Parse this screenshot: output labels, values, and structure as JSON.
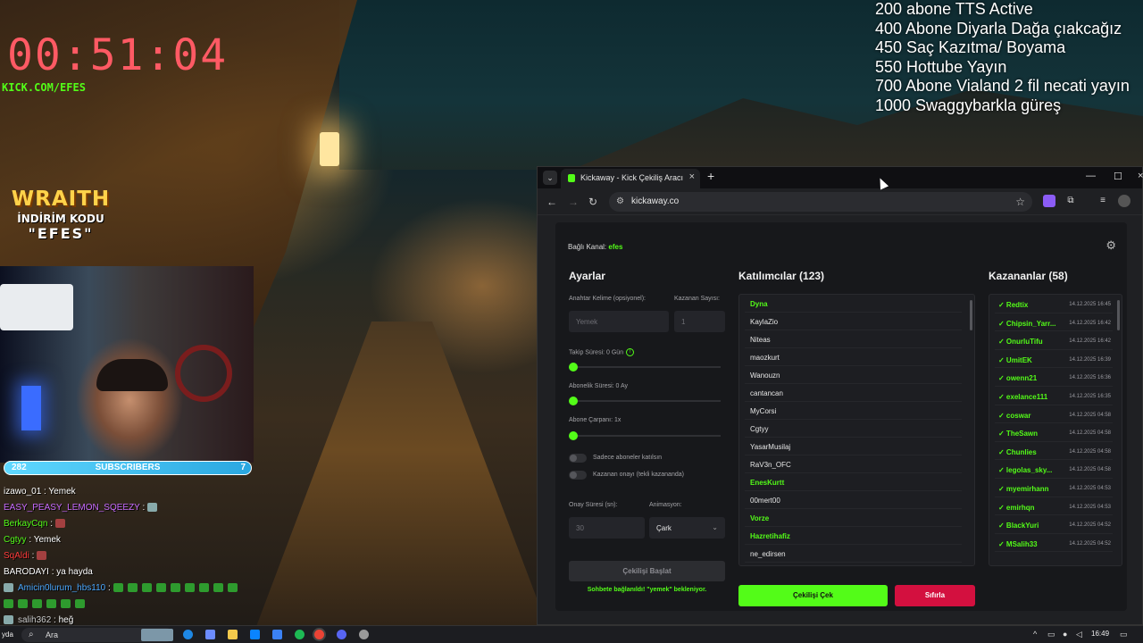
{
  "overlay": {
    "timer": "00:51:04",
    "kick_url": "KICK.COM/EFES",
    "goals": [
      "200 abone TTS Active",
      "400 Abone Diyarla Dağa çıakcağız",
      "450 Saç Kazıtma/ Boyama",
      "550 Hottube Yayın",
      "700 Abone Vialand 2 fil necati yayın",
      "1000 Swaggybarkla güreş"
    ],
    "sponsor": {
      "brand": "WRAITH",
      "code_label": "İNDİRİM KODU",
      "code": "\"EFES\""
    },
    "subscribers": {
      "current": "282",
      "label": "SUBSCRIBERS",
      "right": "7"
    }
  },
  "chat": [
    {
      "user": "izawo_01",
      "color": "#ffffff",
      "message": " : Yemek"
    },
    {
      "user": "EASY_PEASY_LEMON_SQEEZY",
      "color": "#c86bff",
      "message": " : "
    },
    {
      "user": "BerkayCqn",
      "color": "#53fc18",
      "message": " : "
    },
    {
      "user": "Cgtyy",
      "color": "#53fc18",
      "message": " : Yemek"
    },
    {
      "user": "SqAldi",
      "color": "#ff3b3b",
      "message": " : "
    },
    {
      "user": "BARODAYI",
      "color": "#ffffff",
      "message": " : ya hayda"
    },
    {
      "user": "Amicin0lurum_hbs110",
      "color": "#4aa8ff",
      "message": " : "
    },
    {
      "user": "",
      "color": "#ffffff",
      "message": ""
    },
    {
      "user": "salih362",
      "color": "#cccccc",
      "message": " : heğ"
    }
  ],
  "browser": {
    "tab_title": "Kickaway - Kick Çekiliş Aracı",
    "url": "kickaway.co"
  },
  "app": {
    "channel_label": "Bağlı Kanal:",
    "channel_name": "efes",
    "settings": {
      "title": "Ayarlar",
      "keyword_label": "Anahtar Kelime (opsiyonel):",
      "keyword_value": "Yemek",
      "winner_count_label": "Kazanan Sayısı:",
      "winner_count_value": "1",
      "follow_label": "Takip Süresi: 0 Gün",
      "follow_info": "!",
      "sub_label": "Abonelik Süresi: 0 Ay",
      "multiplier_label": "Abone Çarpanı: 1x",
      "toggle_subs_only": "Sadece aboneler katılsın",
      "toggle_winner_confirm": "Kazanan onayı (tekli kazananda)",
      "confirm_time_label": "Onay Süresi (sn):",
      "confirm_time_value": "30",
      "animation_label": "Animasyon:",
      "animation_value": "Çark",
      "start_button": "Çekilişi Başlat",
      "status": "Sohbete bağlanıldı! \"yemek\" bekleniyor."
    },
    "participants": {
      "title": "Katılımcılar (123)",
      "items": [
        {
          "name": "Dyna",
          "highlight": true
        },
        {
          "name": "KaylaZio",
          "highlight": false
        },
        {
          "name": "Niteas",
          "highlight": false
        },
        {
          "name": "maozkurt",
          "highlight": false
        },
        {
          "name": "Wanouzn",
          "highlight": false
        },
        {
          "name": "cantancan",
          "highlight": false
        },
        {
          "name": "MyCorsi",
          "highlight": false
        },
        {
          "name": "Cgtyy",
          "highlight": false
        },
        {
          "name": "YasarMusilaj",
          "highlight": false
        },
        {
          "name": "RaV3n_OFC",
          "highlight": false
        },
        {
          "name": "EnesKurtt",
          "highlight": true
        },
        {
          "name": "00mert00",
          "highlight": false
        },
        {
          "name": "Vorze",
          "highlight": true
        },
        {
          "name": "Hazretihafiz",
          "highlight": true
        },
        {
          "name": "ne_edirsen",
          "highlight": false
        }
      ]
    },
    "winners": {
      "title": "Kazananlar (58)",
      "items": [
        {
          "name": "✓ Redtix",
          "time": "14.12.2025 16:45"
        },
        {
          "name": "✓ Chipsin_Yarr...",
          "time": "14.12.2025 16:42"
        },
        {
          "name": "✓ OnurluTifu",
          "time": "14.12.2025 16:42"
        },
        {
          "name": "✓ UmitEK",
          "time": "14.12.2025 16:39"
        },
        {
          "name": "✓ owenn21",
          "time": "14.12.2025 16:36"
        },
        {
          "name": "✓ exelance111",
          "time": "14.12.2025 16:35"
        },
        {
          "name": "✓ coswar",
          "time": "14.12.2025 04:58"
        },
        {
          "name": "✓ TheSawn",
          "time": "14.12.2025 04:58"
        },
        {
          "name": "✓ Chunlies",
          "time": "14.12.2025 04:58"
        },
        {
          "name": "✓ legolas_sky...",
          "time": "14.12.2025 04:58"
        },
        {
          "name": "✓ myemirhann",
          "time": "14.12.2025 04:53"
        },
        {
          "name": "✓ emirhqn",
          "time": "14.12.2025 04:53"
        },
        {
          "name": "✓ BlackYuri",
          "time": "14.12.2025 04:52"
        },
        {
          "name": "✓ MSalih33",
          "time": "14.12.2025 04:52"
        }
      ]
    },
    "draw_button": "Çekilişi Çek",
    "reset_button": "Sıfırla"
  },
  "taskbar": {
    "start_label": "yda",
    "search_placeholder": "Ara",
    "clock": "16:49"
  }
}
